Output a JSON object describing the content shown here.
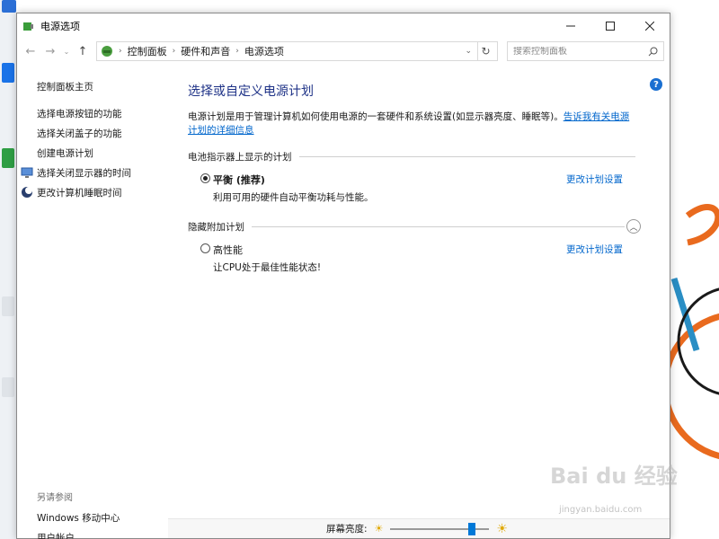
{
  "window": {
    "title": "电源选项"
  },
  "address": {
    "breadcrumb": [
      "控制面板",
      "硬件和声音",
      "电源选项"
    ],
    "search_placeholder": "搜索控制面板"
  },
  "sidebar": {
    "home": "控制面板主页",
    "items": [
      {
        "label": "选择电源按钮的功能"
      },
      {
        "label": "选择关闭盖子的功能"
      },
      {
        "label": "创建电源计划"
      },
      {
        "label": "选择关闭显示器的时间"
      },
      {
        "label": "更改计算机睡眠时间"
      }
    ],
    "see_also": "另请参阅",
    "bottom_items": [
      {
        "label": "Windows 移动中心"
      },
      {
        "label": "用户帐户"
      }
    ]
  },
  "main": {
    "heading": "选择或自定义电源计划",
    "description": "电源计划是用于管理计算机如何使用电源的一套硬件和系统设置(如显示器亮度、睡眠等)。",
    "description_link": "告诉我有关电源计划的详细信息",
    "section_battery": "电池指示器上显示的计划",
    "section_hidden": "隐藏附加计划",
    "plans": [
      {
        "name": "平衡 (推荐)",
        "desc": "利用可用的硬件自动平衡功耗与性能。",
        "selected": true,
        "settings": "更改计划设置"
      },
      {
        "name": "高性能",
        "desc": "让CPU处于最佳性能状态!",
        "selected": false,
        "settings": "更改计划设置"
      }
    ]
  },
  "status": {
    "brightness_label": "屏幕亮度:",
    "brightness": 0.85
  },
  "watermark": {
    "text": "Bai du 经验",
    "sub": "jingyan.baidu.com"
  },
  "colors": {
    "accent": "#0078d7",
    "link": "#0066cc",
    "heading": "#1e3287"
  }
}
